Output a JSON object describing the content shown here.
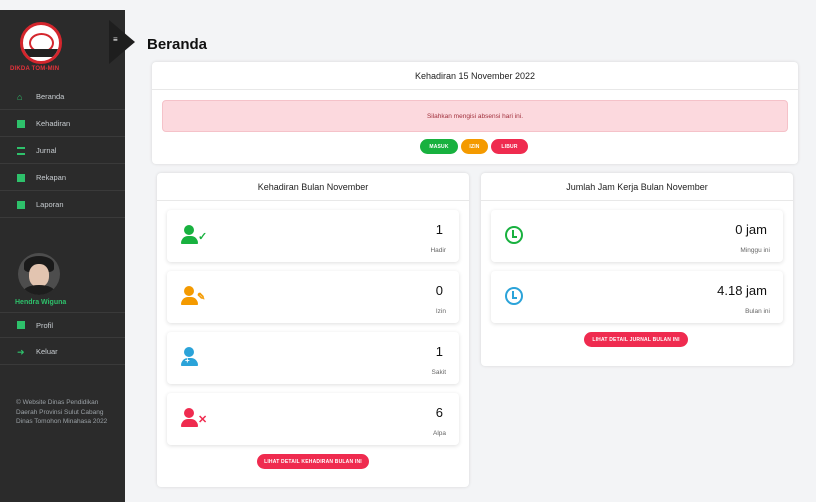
{
  "brand": {
    "org": "DIKDA TOM-MIN"
  },
  "sidebar": {
    "items": [
      {
        "label": "Beranda",
        "icon": "home-icon"
      },
      {
        "label": "Kehadiran",
        "icon": "calendar-icon"
      },
      {
        "label": "Jurnal",
        "icon": "list-icon"
      },
      {
        "label": "Rekapan",
        "icon": "table-icon"
      },
      {
        "label": "Laporan",
        "icon": "report-icon"
      }
    ],
    "user": {
      "name": "Hendra Wiguna"
    },
    "bottom_items": [
      {
        "label": "Profil",
        "icon": "id-card-icon"
      },
      {
        "label": "Keluar",
        "icon": "logout-icon"
      }
    ],
    "footer": "© Website Dinas Pendidikan Daerah Provinsi Sulut Cabang Dinas Tomohon Minahasa 2022"
  },
  "page": {
    "title": "Beranda"
  },
  "attendance_today": {
    "title": "Kehadiran 15 November 2022",
    "alert": "Silahkan mengisi absensi hari ini.",
    "buttons": {
      "masuk": "MASUK",
      "izin": "IZIN",
      "libur": "LIBUR"
    }
  },
  "monthly_attendance": {
    "title": "Kehadiran Bulan November",
    "stats": [
      {
        "value": "1",
        "label": "Hadir",
        "icon": "user-check-icon",
        "color": "#18b13f"
      },
      {
        "value": "0",
        "label": "Izin",
        "icon": "user-edit-icon",
        "color": "#f49a00"
      },
      {
        "value": "1",
        "label": "Sakit",
        "icon": "user-medical-icon",
        "color": "#2ba3d9"
      },
      {
        "value": "6",
        "label": "Alpa",
        "icon": "user-times-icon",
        "color": "#ef2b4f"
      }
    ],
    "detail_button": "LIHAT DETAIL KEHADIRAN BULAN INI"
  },
  "work_hours": {
    "title": "Jumlah Jam Kerja Bulan November",
    "stats": [
      {
        "value": "0 jam",
        "label": "Minggu ini",
        "icon": "clock-icon",
        "color": "#18b13f"
      },
      {
        "value": "4.18 jam",
        "label": "Bulan ini",
        "icon": "clock-icon",
        "color": "#2ba3d9"
      }
    ],
    "detail_button": "LIHAT DETAIL JURNAL BULAN INI"
  }
}
